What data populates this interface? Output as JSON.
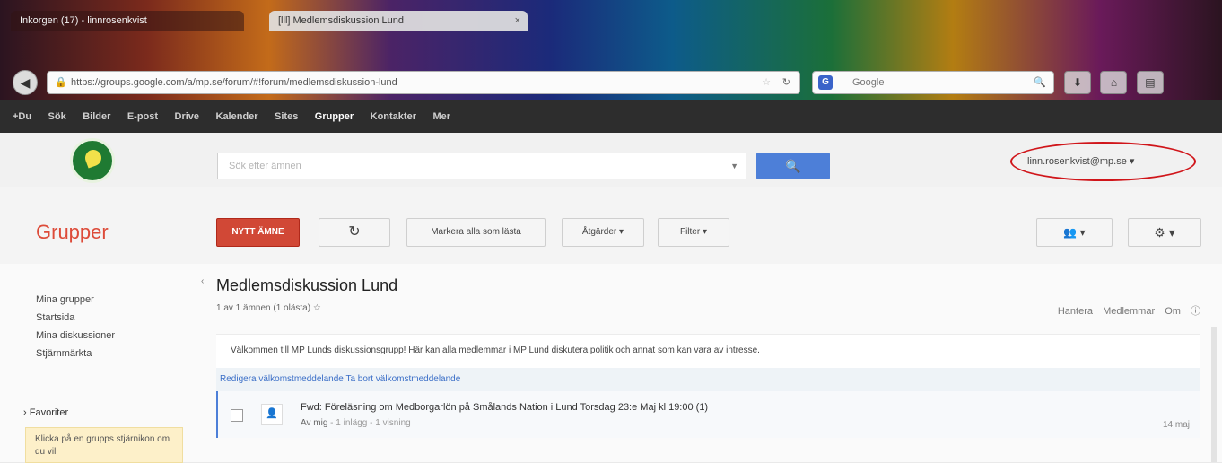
{
  "browser": {
    "tabs": [
      {
        "label": "Inkorgen (17) - linnrosenkvist"
      },
      {
        "label": "[lll] Medlemsdiskussion Lund"
      }
    ],
    "url": "https://groups.google.com/a/mp.se/forum/#!forum/medlemsdiskussion-lund",
    "search_placeholder": "Google",
    "search_engine_badge": "G"
  },
  "gbar": {
    "links": [
      "+Du",
      "Sök",
      "Bilder",
      "E-post",
      "Drive",
      "Kalender",
      "Sites",
      "Grupper",
      "Kontakter",
      "Mer"
    ],
    "active": "Grupper"
  },
  "header": {
    "search_placeholder": "Sök efter ämnen",
    "account": "linn.rosenkvist@mp.se"
  },
  "toolbar": {
    "brand": "Grupper",
    "new_topic": "NYTT ÄMNE",
    "mark_all": "Markera alla som lästa",
    "actions": "Åtgärder",
    "filter": "Filter"
  },
  "sidebar": {
    "items": [
      "Mina grupper",
      "Startsida",
      "Mina diskussioner",
      "Stjärnmärkta"
    ],
    "favorites_label": "Favoriter",
    "hint": "Klicka på en grupps stjärnikon om du vill"
  },
  "forum": {
    "title": "Medlemsdiskussion Lund",
    "count": "1 av 1 ämnen (1 olästa)",
    "manage_links": [
      "Hantera",
      "Medlemmar",
      "Om"
    ],
    "welcome": "Välkommen till MP Lunds diskussionsgrupp! Här kan alla medlemmar i MP Lund diskutera politik och annat som kan vara av intresse.",
    "welcome_links": "Redigera välkomstmeddelande Ta bort välkomstmeddelande",
    "topic": {
      "subject": "Fwd: Föreläsning om Medborgarlön på Smålands Nation i Lund Torsdag 23:e Maj kl 19:00  (1)",
      "author": "Av mig",
      "posts": "1 inlägg",
      "views": "1 visning",
      "date": "14 maj"
    }
  }
}
